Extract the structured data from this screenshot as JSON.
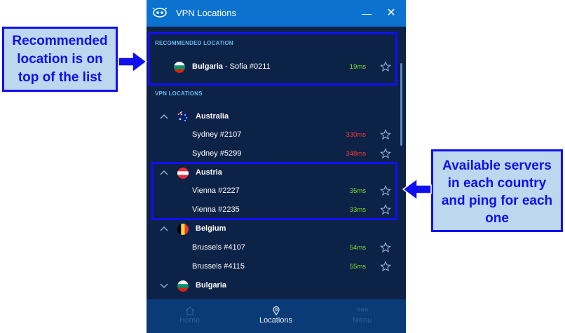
{
  "window": {
    "title": "VPN Locations",
    "minimize_glyph": "—",
    "close_glyph": "✕"
  },
  "recommended": {
    "header": "RECOMMENDED LOCATION",
    "country": "Bulgaria",
    "separator": " - ",
    "server": "Sofia #0211",
    "ping": "19ms",
    "flag": "bulgaria-flag"
  },
  "locations_header": "VPN LOCATIONS",
  "countries": [
    {
      "name": "Australia",
      "expanded": true,
      "flag": "australia-flag",
      "servers": [
        {
          "name": "Sydney #2107",
          "ping": "330ms",
          "status": "red"
        },
        {
          "name": "Sydney #5299",
          "ping": "348ms",
          "status": "red"
        }
      ]
    },
    {
      "name": "Austria",
      "expanded": true,
      "flag": "austria-flag",
      "servers": [
        {
          "name": "Vienna #2227",
          "ping": "35ms",
          "status": "green"
        },
        {
          "name": "Vienna #2235",
          "ping": "33ms",
          "status": "green"
        }
      ]
    },
    {
      "name": "Belgium",
      "expanded": true,
      "flag": "belgium-flag",
      "servers": [
        {
          "name": "Brussels #4107",
          "ping": "54ms",
          "status": "green"
        },
        {
          "name": "Brussels #4115",
          "ping": "55ms",
          "status": "green"
        }
      ]
    },
    {
      "name": "Bulgaria",
      "expanded": false,
      "flag": "bulgaria-flag",
      "servers": []
    }
  ],
  "nav": [
    {
      "label": "Home",
      "icon": "home-icon",
      "active": false
    },
    {
      "label": "Locations",
      "icon": "location-pin-icon",
      "active": true
    },
    {
      "label": "Menu",
      "icon": "menu-dots-icon",
      "active": false
    }
  ],
  "callouts": {
    "left": [
      "Recommended",
      "location is on",
      "top of the list"
    ],
    "right": [
      "Available servers",
      "in each country",
      "and ping for each",
      "one"
    ]
  },
  "colors": {
    "titlebar": "#0b72d0",
    "background": "#0d2247",
    "accent_blue": "#1010ee",
    "ping_good": "#7be12d",
    "ping_bad": "#ff3838"
  }
}
